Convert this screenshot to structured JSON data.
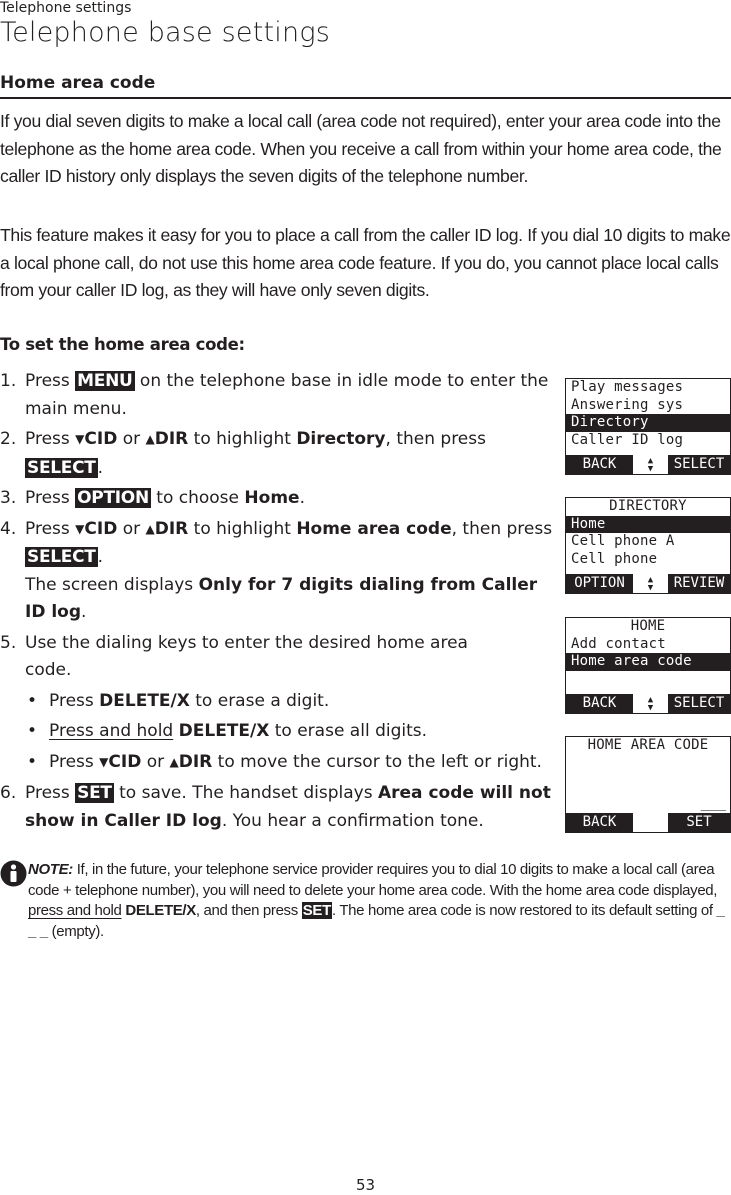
{
  "header": {
    "section": "Telephone settings",
    "title": "Telephone base settings"
  },
  "section_heading": "Home area code",
  "paragraphs": {
    "p1": "If you dial seven digits to make a local call (area code not required), enter your area code into the telephone as the home area code. When you receive a call from within your home area code, the caller ID history only displays the seven digits of the telephone number.",
    "p2": "This feature makes it easy for you to place a call from the caller ID log. If you dial 10 digits to make a local phone call, do not use this home area code feature. If you do, you cannot place local calls from your caller ID log, as they will have only seven digits."
  },
  "procedure_heading": "To set the home area code:",
  "keys": {
    "menu": "MENU",
    "select": "SELECT",
    "option": "OPTION",
    "set": "SET",
    "cid": "CID",
    "dir": "DIR",
    "delete": "DELETE/X",
    "down_arrow": "▼",
    "up_arrow": "▲"
  },
  "steps": {
    "s1": {
      "num": "1.",
      "a": "Press ",
      "b": " on the telephone base in idle mode to enter the main menu."
    },
    "s2": {
      "num": "2.",
      "a": "Press ",
      "or": " or ",
      "c": " to highlight ",
      "target": "Directory",
      "d": ", then press ",
      "end": "."
    },
    "s3": {
      "num": "3.",
      "a": "Press ",
      "b": " to choose ",
      "target": "Home",
      "end": "."
    },
    "s4": {
      "num": "4.",
      "a": "Press ",
      "or": " or ",
      "c": " to highlight ",
      "target": "Home area code",
      "d": ", then press ",
      "end": ".",
      "e": "The screen displays ",
      "msg": "Only for 7 digits dialing from Caller ID log",
      "end2": "."
    },
    "s5": {
      "num": "5.",
      "text": "Use the dialing keys to enter the desired home area code."
    },
    "b1": {
      "a": "Press ",
      "b": " to erase a digit."
    },
    "b2": {
      "link": "Press and hold",
      "b": " to erase all digits."
    },
    "b3": {
      "a": "Press ",
      "or": " or ",
      "c": " to move the cursor to the left or right."
    },
    "s6": {
      "num": "6.",
      "a": "Press ",
      "b": " to save. The handset displays ",
      "msg": "Area code will not show in Caller ID log",
      "c": ". You hear a confirmation tone."
    },
    "bullet_glyph": "•"
  },
  "screens": {
    "main_menu": {
      "rows": [
        "Play messages",
        "Answering sys",
        "Directory",
        "Caller ID log"
      ],
      "selected": "Directory",
      "left": "BACK",
      "right": "SELECT"
    },
    "directory": {
      "title": "DIRECTORY",
      "rows": [
        "Home",
        "Cell phone A",
        "Cell phone"
      ],
      "selected": "Home",
      "left": "OPTION",
      "right": "REVIEW"
    },
    "home": {
      "title": "HOME",
      "rows": [
        "Add contact",
        "Home area code"
      ],
      "selected": "Home area code",
      "left": "BACK",
      "right": "SELECT"
    },
    "home_area_code": {
      "title": "HOME AREA CODE",
      "value": "___",
      "left": "BACK",
      "right": "SET"
    }
  },
  "note": {
    "lead": "NOTE:",
    "a": " If, in the future, your telephone service provider requires you to dial 10 digits to make a local call (area code + telephone number), you will need to delete your home area code. With the home area code displayed, ",
    "link": "press and hold",
    "b": ", and then press ",
    "c": ". The home area code is now restored to its default setting of ",
    "default_value": "_ _ _",
    "d": " (empty)."
  },
  "page_number": "53"
}
